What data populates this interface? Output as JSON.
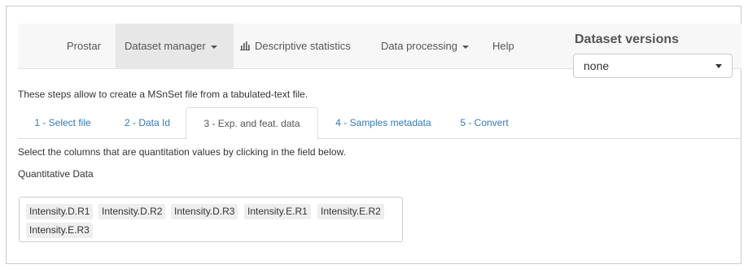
{
  "navbar": {
    "items": [
      {
        "label": "Prostar"
      },
      {
        "label": "Dataset manager",
        "dropdown": true,
        "active": true
      },
      {
        "label": "Descriptive statistics",
        "icon": "bar-chart-icon"
      },
      {
        "label": "Data processing",
        "dropdown": true
      },
      {
        "label": "Help"
      }
    ]
  },
  "versions": {
    "title": "Dataset versions",
    "selected": "none"
  },
  "intro_text": "These steps allow to create a MSnSet file from a tabulated-text file.",
  "tabs": [
    {
      "label": "1 - Select file"
    },
    {
      "label": "2 - Data Id"
    },
    {
      "label": "3 - Exp. and feat. data",
      "active": true
    },
    {
      "label": "4 - Samples metadata"
    },
    {
      "label": "5 - Convert"
    }
  ],
  "help_text": "Select the columns that are quantitation values by clicking in the field below.",
  "field_label": "Quantitative Data",
  "selected_columns": [
    "Intensity.D.R1",
    "Intensity.D.R2",
    "Intensity.D.R3",
    "Intensity.E.R1",
    "Intensity.E.R2",
    "Intensity.E.R3"
  ],
  "colors": {
    "link": "#337ab7",
    "navbar_bg": "#f7f7f7",
    "active_nav_bg": "#e7e7e7",
    "chip_bg": "#eeeeee"
  }
}
